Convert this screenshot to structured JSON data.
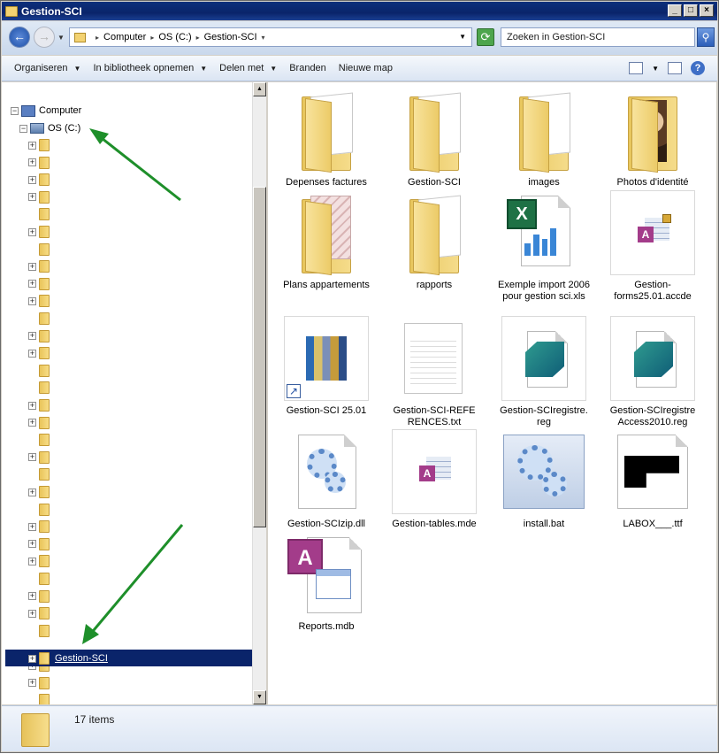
{
  "window": {
    "title": "Gestion-SCI"
  },
  "address": {
    "crumbs": [
      "Computer",
      "OS (C:)",
      "Gestion-SCI"
    ]
  },
  "search": {
    "placeholder": "Zoeken in Gestion-SCI"
  },
  "toolbar": {
    "organize": "Organiseren",
    "library": "In bibliotheek opnemen",
    "share": "Delen met",
    "burn": "Branden",
    "new_folder": "Nieuwe map"
  },
  "nav": {
    "computer": "Computer",
    "drive": "OS (C:)",
    "selected": "Gestion-SCI"
  },
  "files": [
    {
      "name": "Depenses factures",
      "icon": "folder-icon"
    },
    {
      "name": "Gestion-SCI",
      "icon": "folder-icon"
    },
    {
      "name": "images",
      "icon": "folder-icon"
    },
    {
      "name": "Photos d'identité",
      "icon": "folder-photos-icon"
    },
    {
      "name": "Plans appartements",
      "icon": "folder-icon"
    },
    {
      "name": "rapports",
      "icon": "folder-icon"
    },
    {
      "name": "Exemple import 2006 pour gestion sci.xls",
      "icon": "excel-file-icon"
    },
    {
      "name": "Gestion-forms25.01.accde",
      "icon": "access-file-icon"
    },
    {
      "name": "Gestion-SCI 25.01",
      "icon": "shortcut-icon"
    },
    {
      "name": "Gestion-SCI-REFERENCES.txt",
      "icon": "text-file-icon"
    },
    {
      "name": "Gestion-SCIregistre.reg",
      "icon": "registry-file-icon"
    },
    {
      "name": "Gestion-SCIregistreAccess2010.reg",
      "icon": "registry-file-icon"
    },
    {
      "name": "Gestion-SCIzip.dll",
      "icon": "dll-file-icon"
    },
    {
      "name": "Gestion-tables.mde",
      "icon": "access-file-icon"
    },
    {
      "name": "install.bat",
      "icon": "batch-file-icon"
    },
    {
      "name": "LABOX___.ttf",
      "icon": "font-file-icon"
    },
    {
      "name": "Reports.mdb",
      "icon": "access-db-icon"
    }
  ],
  "status": {
    "count": "17 items"
  },
  "colors": {
    "selection": "#0a246a",
    "arrow": "#1e8f2a"
  }
}
